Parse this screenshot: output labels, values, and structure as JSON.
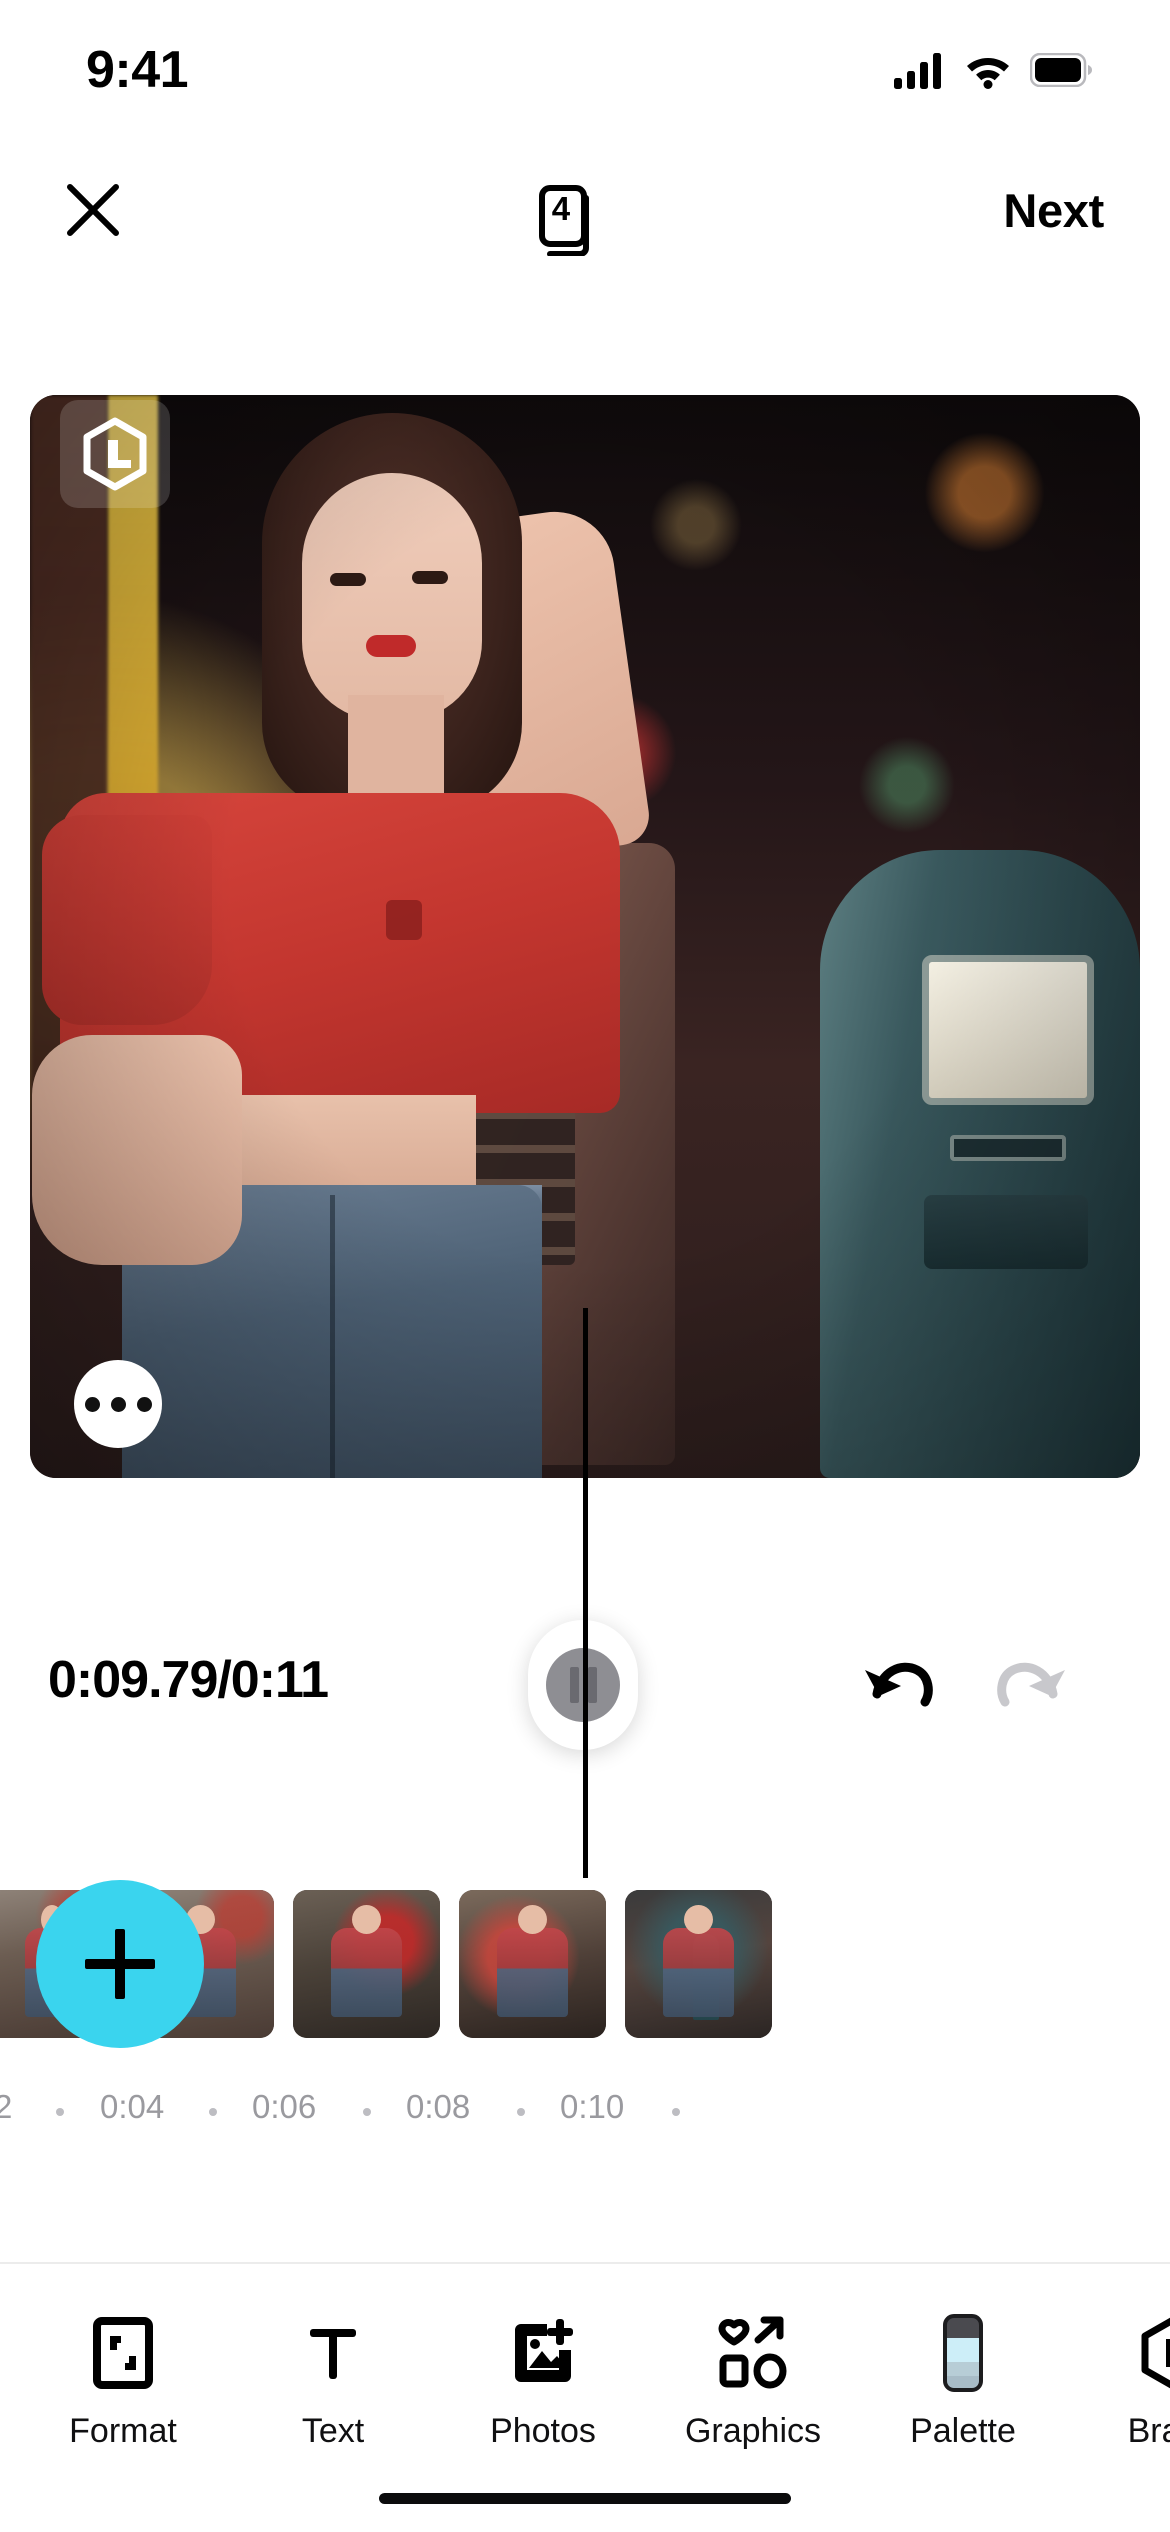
{
  "status_bar": {
    "time": "9:41",
    "icons": [
      "cellular-signal-icon",
      "wifi-icon",
      "battery-icon"
    ]
  },
  "nav_bar": {
    "close_icon": "close-icon",
    "pages_icon": "pages-stack-icon",
    "pages_count": "4",
    "next_label": "Next"
  },
  "preview": {
    "watermark_icon": "brand-hexagon-l-icon",
    "more_options_icon": "more-horizontal-icon"
  },
  "controls": {
    "timecode": "0:09.79/0:11",
    "current_time": "0:09.79",
    "total_time": "0:11",
    "play_state": "playing",
    "pause_icon": "pause-icon",
    "undo_icon": "undo-icon",
    "redo_icon": "redo-icon",
    "undo_enabled": true,
    "redo_enabled": false,
    "accent_color": "#3ad4ee",
    "knob_color": "#8e8e93"
  },
  "timeline": {
    "add_clip_icon": "plus-icon",
    "add_clip_color": "#3ad4ee",
    "clips": [
      {
        "name": "clip-1"
      },
      {
        "name": "clip-2"
      },
      {
        "name": "clip-3"
      },
      {
        "name": "clip-4"
      }
    ],
    "ruler_ticks": [
      "2",
      "0:04",
      "0:06",
      "0:08",
      "0:10"
    ],
    "playhead_position": "0:09.79"
  },
  "toolbar": {
    "items": [
      {
        "label": "Format",
        "icon": "format-frame-icon"
      },
      {
        "label": "Text",
        "icon": "text-t-icon"
      },
      {
        "label": "Photos",
        "icon": "photo-add-icon"
      },
      {
        "label": "Graphics",
        "icon": "graphics-shapes-icon"
      },
      {
        "label": "Palette",
        "icon": "palette-swatch-icon"
      },
      {
        "label": "Brand",
        "icon": "brand-hexagon-l-icon"
      }
    ]
  }
}
